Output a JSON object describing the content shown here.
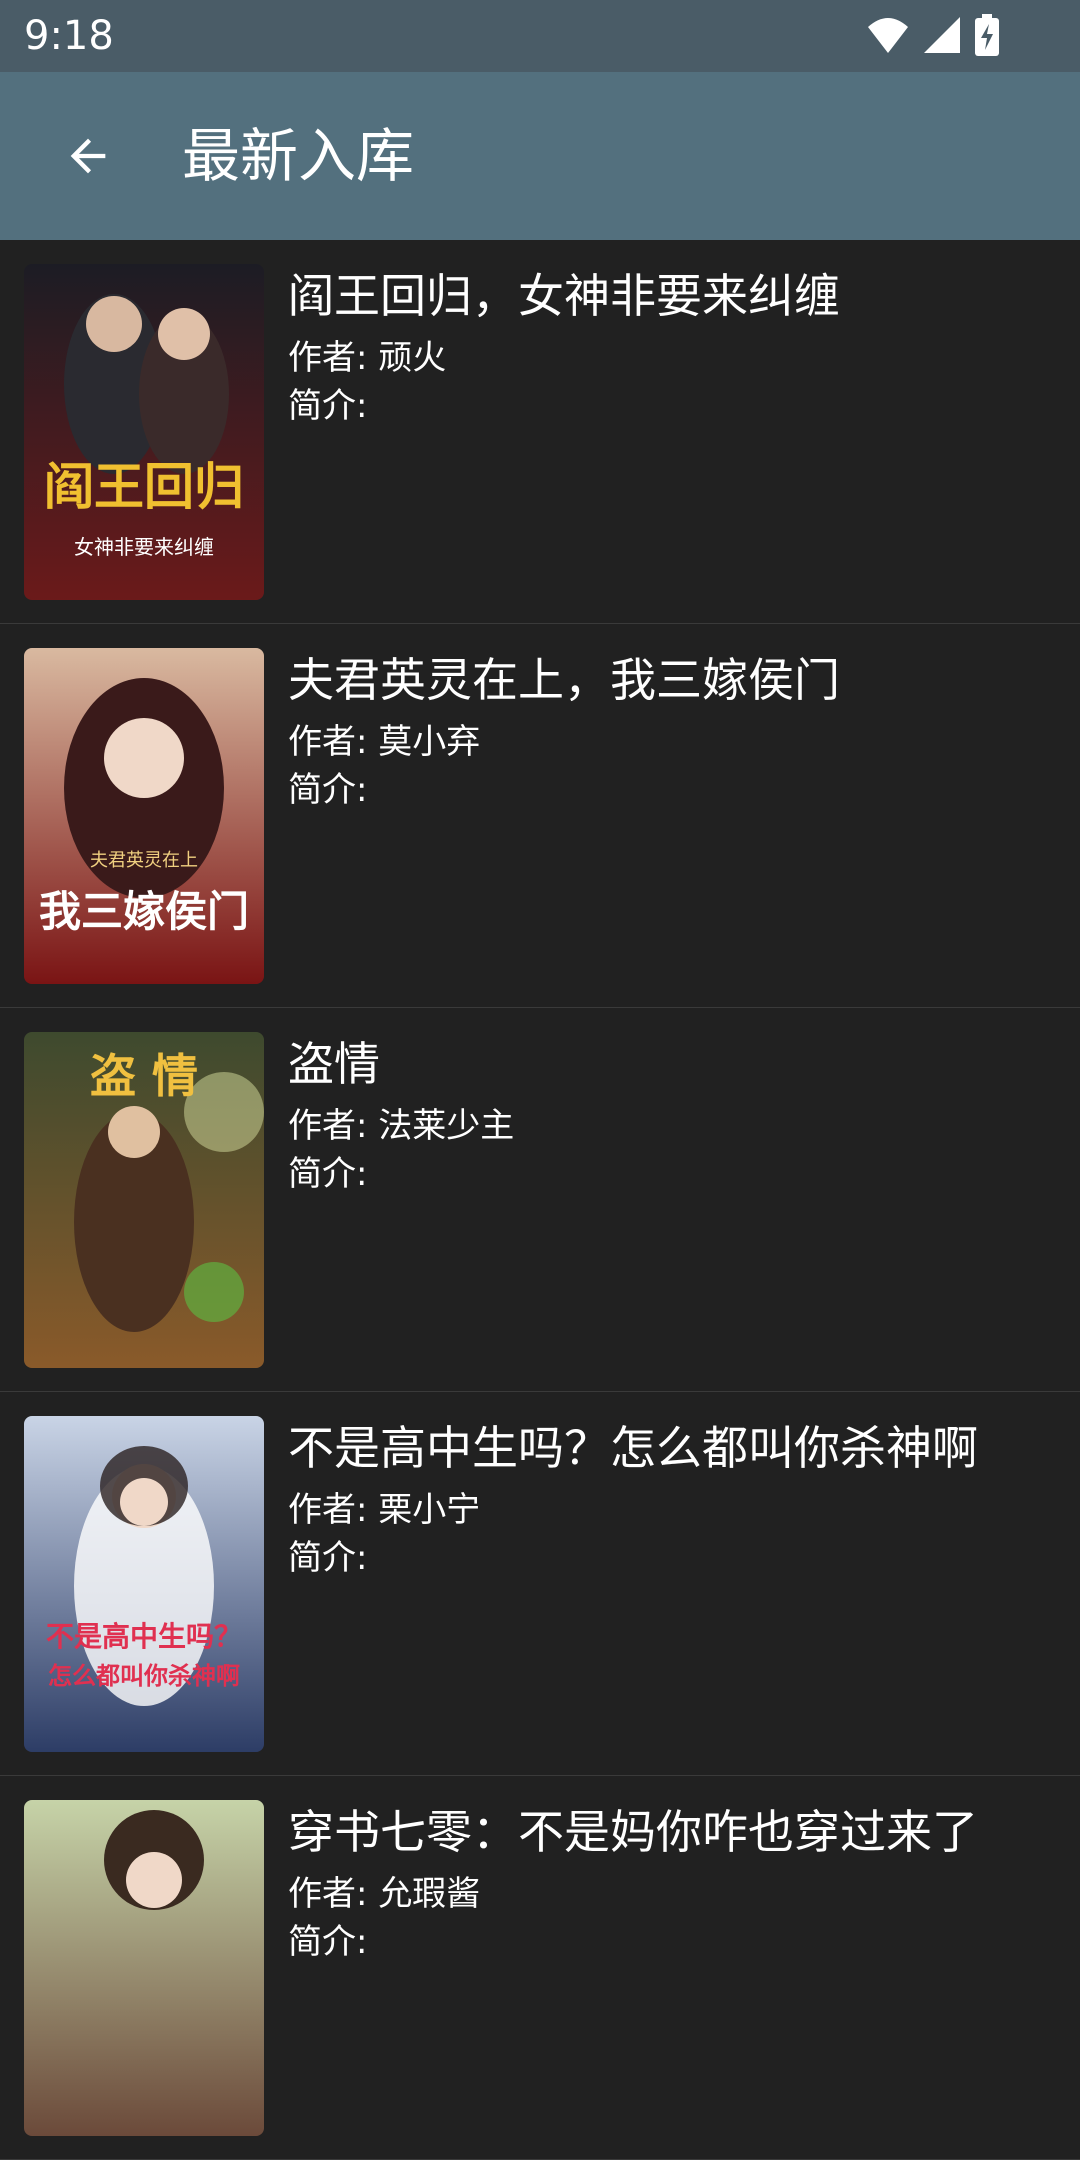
{
  "status_bar": {
    "time": "9:18",
    "icons": [
      "wifi-icon",
      "signal-icon",
      "battery-charging-icon"
    ]
  },
  "app_bar": {
    "back_icon": "arrow-back-icon",
    "title": "最新入库"
  },
  "labels": {
    "author_prefix": "作者: ",
    "intro_prefix": "简介:"
  },
  "books": [
    {
      "title": "阎王回归，女神非要来纠缠",
      "author": "作者: 顽火",
      "intro": "简介:",
      "cover_text": "阎王回归",
      "cover_subtext": "女神非要来纠缠",
      "cover_colors": [
        "#1c1c24",
        "#6b1a1a"
      ]
    },
    {
      "title": "夫君英灵在上，我三嫁侯门",
      "author": "作者: 莫小弃",
      "intro": "简介:",
      "cover_text": "我三嫁侯门",
      "cover_subtext": "夫君英灵在上",
      "cover_colors": [
        "#d9b9a0",
        "#7a1414"
      ]
    },
    {
      "title": "盗情",
      "author": "作者: 法莱少主",
      "intro": "简介:",
      "cover_text": "盗 情",
      "cover_subtext": "",
      "cover_colors": [
        "#3e4a2e",
        "#8a5a2a"
      ]
    },
    {
      "title": "不是高中生吗？怎么都叫你杀神啊",
      "author": "作者: 栗小宁",
      "intro": "简介:",
      "cover_text": "不是高中生吗？",
      "cover_subtext": "怎么都叫你杀神啊",
      "cover_colors": [
        "#c9d4e6",
        "#2d3d66"
      ]
    },
    {
      "title": "穿书七零：不是妈你咋也穿过来了",
      "author": "作者: 允瑕酱",
      "intro": "简介:",
      "cover_text": "",
      "cover_subtext": "",
      "cover_colors": [
        "#c6d3a8",
        "#6b4a3a"
      ]
    }
  ]
}
